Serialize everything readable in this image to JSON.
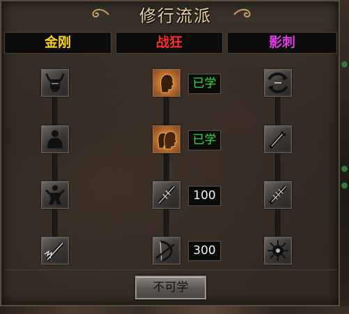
{
  "window": {
    "title": "修行流派"
  },
  "columns": [
    {
      "label": "金刚",
      "color": "#ffd21f"
    },
    {
      "label": "战狂",
      "color": "#ff2a2a"
    },
    {
      "label": "影刺",
      "color": "#e23de6"
    }
  ],
  "jingang_skills": [
    {
      "icon": "horned-helmet-icon"
    },
    {
      "icon": "body-silhouette-icon"
    },
    {
      "icon": "warrior-figure-icon"
    },
    {
      "icon": "flaming-sword-icon"
    }
  ],
  "zhankuang_skills": [
    {
      "icon": "head-silhouette-icon",
      "status": "已学",
      "learned": true
    },
    {
      "icon": "double-head-icon",
      "status": "已学",
      "learned": true
    },
    {
      "icon": "spiked-sword-icon",
      "status": "100",
      "learned": false
    },
    {
      "icon": "bow-icon",
      "status": "300",
      "learned": false
    }
  ],
  "yingci_skills": [
    {
      "icon": "whirlwind-icon"
    },
    {
      "icon": "dagger-icon"
    },
    {
      "icon": "spiked-dagger-icon"
    },
    {
      "icon": "dark-burst-icon"
    }
  ],
  "footer": {
    "button_label": "不可学"
  },
  "colors": {
    "learned_text": "#2ee02e",
    "cost_text": "#f2f2f2"
  }
}
